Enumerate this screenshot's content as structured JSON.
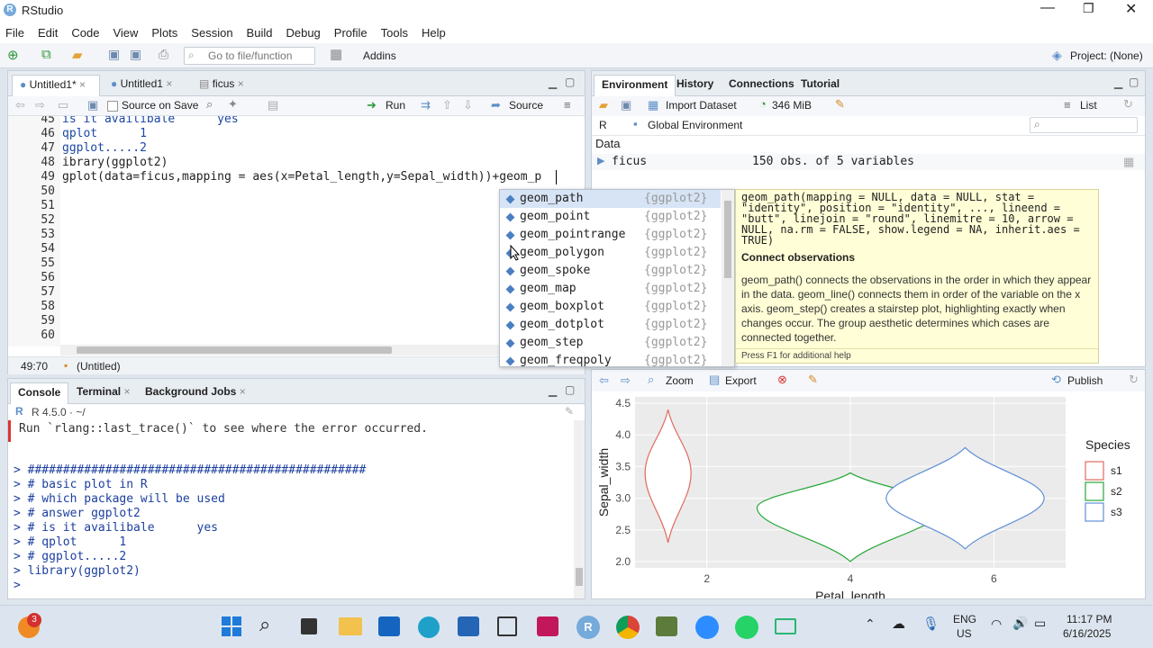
{
  "app": {
    "title": "RStudio",
    "project": "Project: (None)"
  },
  "menu": [
    "File",
    "Edit",
    "Code",
    "View",
    "Plots",
    "Session",
    "Build",
    "Debug",
    "Profile",
    "Tools",
    "Help"
  ],
  "toolbar": {
    "goto_placeholder": "Go to file/function",
    "addins": "Addins"
  },
  "editor": {
    "tabs": [
      "Untitled1*",
      "Untitled1",
      "ficus"
    ],
    "source_on_save": "Source on Save",
    "run": "Run",
    "source": "Source",
    "lines": [
      {
        "n": "45",
        "t": "is it availibale      yes"
      },
      {
        "n": "46",
        "t": "qplot      1"
      },
      {
        "n": "47",
        "t": "ggplot.....2"
      },
      {
        "n": "48",
        "t": "ibrary(ggplot2)"
      },
      {
        "n": "49",
        "t": "gplot(data=ficus,mapping = aes(x=Petal_length,y=Sepal_width))+geom_p"
      },
      {
        "n": "50",
        "t": ""
      },
      {
        "n": "51",
        "t": ""
      },
      {
        "n": "52",
        "t": ""
      },
      {
        "n": "53",
        "t": ""
      },
      {
        "n": "54",
        "t": ""
      },
      {
        "n": "55",
        "t": ""
      },
      {
        "n": "56",
        "t": ""
      },
      {
        "n": "57",
        "t": ""
      },
      {
        "n": "58",
        "t": ""
      },
      {
        "n": "59",
        "t": ""
      },
      {
        "n": "60",
        "t": ""
      }
    ],
    "status_pos": "49:70",
    "status_file": "(Untitled)"
  },
  "autocomplete": {
    "items": [
      {
        "name": "geom_path",
        "pkg": "{ggplot2}"
      },
      {
        "name": "geom_point",
        "pkg": "{ggplot2}"
      },
      {
        "name": "geom_pointrange",
        "pkg": "{ggplot2}"
      },
      {
        "name": "geom_polygon",
        "pkg": "{ggplot2}"
      },
      {
        "name": "geom_spoke",
        "pkg": "{ggplot2}"
      },
      {
        "name": "geom_map",
        "pkg": "{ggplot2}"
      },
      {
        "name": "geom_boxplot",
        "pkg": "{ggplot2}"
      },
      {
        "name": "geom_dotplot",
        "pkg": "{ggplot2}"
      },
      {
        "name": "geom_step",
        "pkg": "{ggplot2}"
      },
      {
        "name": "geom_freqpoly",
        "pkg": "{ggplot2}"
      }
    ],
    "help_signature": "geom_path(mapping = NULL, data = NULL, stat = \"identity\", position = \"identity\", ..., lineend = \"butt\", linejoin = \"round\", linemitre = 10, arrow = NULL, na.rm = FALSE, show.legend = NA, inherit.aes = TRUE)",
    "help_title": "Connect observations",
    "help_body": "geom_path() connects the observations in the order in which they appear in the data. geom_line() connects them in order of the variable on the x axis. geom_step() creates a stairstep plot, highlighting exactly when changes occur. The group aesthetic determines which cases are connected together.",
    "help_footer": "Press F1 for additional help"
  },
  "environment": {
    "tabs": [
      "Environment",
      "History",
      "Connections",
      "Tutorial"
    ],
    "import": "Import Dataset",
    "memory": "346 MiB",
    "list": "List",
    "lang": "R",
    "scope": "Global Environment",
    "section": "Data",
    "var_name": "ficus",
    "var_value": "150 obs. of 5 variables"
  },
  "console": {
    "tabs": [
      "Console",
      "Terminal",
      "Background Jobs"
    ],
    "version": "R 4.5.0 · ~/",
    "lines": [
      "Run `rlang::last_trace()` to see where the error occurred.",
      "",
      "> ################################################",
      "> # basic plot in R",
      "> # which package will be used",
      "> # answer ggplot2",
      "> # is it availibale      yes",
      "> # qplot      1",
      "> # ggplot.....2",
      "> library(ggplot2)",
      ">"
    ]
  },
  "plots": {
    "zoom": "Zoom",
    "export": "Export",
    "publish": "Publish"
  },
  "chart_data": {
    "type": "violin",
    "xlabel": "Petal_length",
    "ylabel": "Sepal_width",
    "xticks": [
      "2",
      "4",
      "6"
    ],
    "yticks": [
      "2.0",
      "2.5",
      "3.0",
      "3.5",
      "4.0",
      "4.5"
    ],
    "xlim": [
      1,
      7
    ],
    "ylim": [
      1.9,
      4.6
    ],
    "legend_title": "Species",
    "series": [
      {
        "name": "s1",
        "color": "#e06a5f",
        "x": 1.46,
        "ymin": 2.3,
        "ymax": 4.4,
        "halfwidth": 0.32,
        "peak": 3.4
      },
      {
        "name": "s2",
        "color": "#27a83a",
        "x": 4.0,
        "ymin": 2.0,
        "ymax": 3.4,
        "halfwidth": 1.3,
        "peak": 2.85
      },
      {
        "name": "s3",
        "color": "#5f8fd6",
        "x": 5.6,
        "ymin": 2.2,
        "ymax": 3.8,
        "halfwidth": 1.1,
        "peak": 3.0
      }
    ],
    "grid": true,
    "legend_position": "right"
  },
  "taskbar": {
    "lang1": "ENG",
    "lang2": "US",
    "time": "11:17 PM",
    "date": "6/16/2025",
    "badge": "3"
  }
}
